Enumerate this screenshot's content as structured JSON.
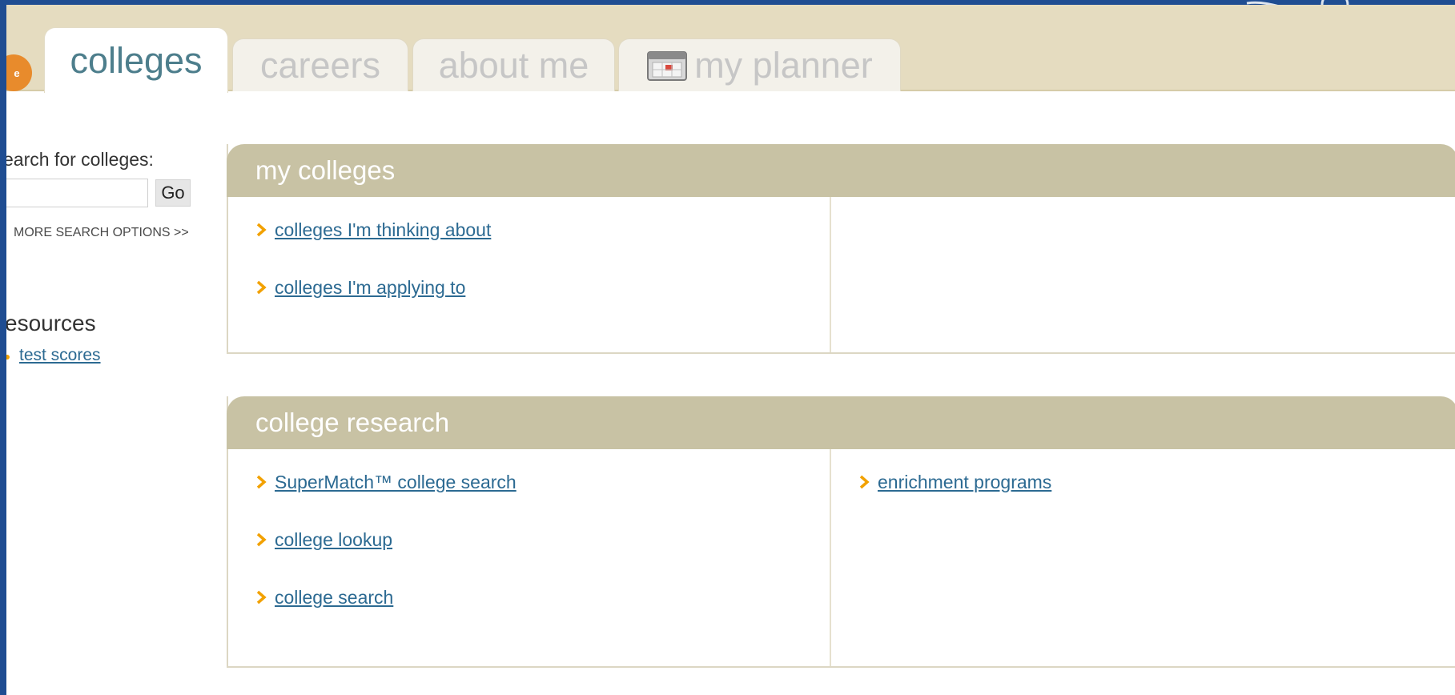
{
  "tabs": {
    "home_badge": "e",
    "colleges": "colleges",
    "careers": "careers",
    "about_me": "about me",
    "my_planner": "my planner"
  },
  "sidebar": {
    "search_label": "earch for colleges:",
    "search_value": "",
    "go_label": "Go",
    "more_options": "MORE SEARCH OPTIONS >>",
    "resources_title": "esources",
    "resources": [
      "test scores"
    ]
  },
  "my_colleges": {
    "title": "my colleges",
    "left_links": [
      "colleges I'm thinking about",
      "colleges I'm applying to"
    ],
    "right_links": []
  },
  "college_research": {
    "title": "college research",
    "left_links": [
      "SuperMatch™ college search",
      "college lookup",
      "college search"
    ],
    "right_links": [
      "enrichment programs"
    ]
  },
  "colors": {
    "desktop_blue": "#1f4d92",
    "tab_bar": "#e5dcc0",
    "panel_header": "#c8c2a4",
    "link": "#2c6a92",
    "chevron": "#f2a100",
    "active_tab_text": "#4d7e8c",
    "home_badge": "#e88b2c"
  }
}
